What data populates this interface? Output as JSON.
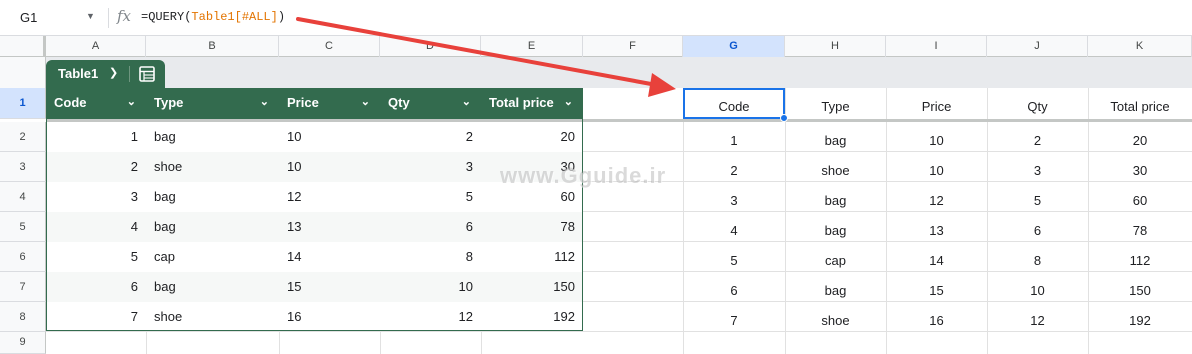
{
  "formula_bar": {
    "name_box": "G1",
    "fx": "fx",
    "formula_prefix": "=QUERY(",
    "formula_ref": "Table1[#ALL]",
    "formula_suffix": ")"
  },
  "columns": [
    "A",
    "B",
    "C",
    "D",
    "E",
    "F",
    "G",
    "H",
    "I",
    "J",
    "K"
  ],
  "rows": [
    "1",
    "2",
    "3",
    "4",
    "5",
    "6",
    "7",
    "8",
    "9"
  ],
  "table": {
    "name": "Table1",
    "headers": [
      "Code",
      "Type",
      "Price",
      "Qty",
      "Total price"
    ],
    "rows": [
      [
        "1",
        "bag",
        "10",
        "2",
        "20"
      ],
      [
        "2",
        "shoe",
        "10",
        "3",
        "30"
      ],
      [
        "3",
        "bag",
        "12",
        "5",
        "60"
      ],
      [
        "4",
        "bag",
        "13",
        "6",
        "78"
      ],
      [
        "5",
        "cap",
        "14",
        "8",
        "112"
      ],
      [
        "6",
        "bag",
        "15",
        "10",
        "150"
      ],
      [
        "7",
        "shoe",
        "16",
        "12",
        "192"
      ]
    ]
  },
  "result": {
    "headers": [
      "Code",
      "Type",
      "Price",
      "Qty",
      "Total price"
    ],
    "rows": [
      [
        "1",
        "bag",
        "10",
        "2",
        "20"
      ],
      [
        "2",
        "shoe",
        "10",
        "3",
        "30"
      ],
      [
        "3",
        "bag",
        "12",
        "5",
        "60"
      ],
      [
        "4",
        "bag",
        "13",
        "6",
        "78"
      ],
      [
        "5",
        "cap",
        "14",
        "8",
        "112"
      ],
      [
        "6",
        "bag",
        "15",
        "10",
        "150"
      ],
      [
        "7",
        "shoe",
        "16",
        "12",
        "192"
      ]
    ]
  },
  "watermark": "www.Gguide.ir",
  "colors": {
    "table_green": "#336b4e",
    "selection_blue": "#1a73e8",
    "arrow_red": "#e8413b"
  }
}
